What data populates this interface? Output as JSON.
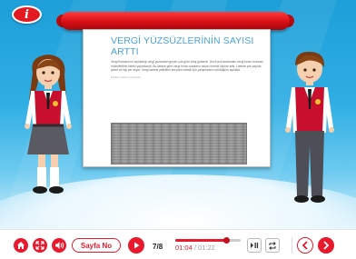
{
  "header": {
    "logo_letter": "i"
  },
  "article": {
    "title": "VERGİ YÜZSÜZLERİNİN SAYISI ARTTI",
    "body": "Vergi Borsası'nın açıkladığı vergi yüzsüzleri geçen yıla göre artış gösterdi. Üst Kurul tarafından vergi borcu bulunan mükelleflerin listesi yayımlandı. Bu listeye göre vergi borcu olanların sayısı önemli ölçüde arttı. Listede çok sayıda şirket ve kişi yer alıyor. Vergi dairesi yetkilileri borçların tahsili için çalışmaların sürdüğünü açıkladı.",
    "meta": "15 Ekim 2014 Çarşamba"
  },
  "controls": {
    "page_button_label": "Sayfa No",
    "page_current": "7",
    "page_total": "8",
    "time_elapsed": "01:04",
    "time_total": "01:22",
    "progress_fraction": 0.78
  },
  "colors": {
    "accent": "#e8192c",
    "sky": "#2faee3",
    "vest": "#c8102e"
  },
  "icons": {
    "home": "home-icon",
    "fullscreen": "fullscreen-icon",
    "volume": "volume-icon",
    "play": "play-icon",
    "pause": "pause-icon",
    "repeat": "repeat-icon",
    "prev": "chevron-left-icon",
    "next": "chevron-right-icon"
  }
}
